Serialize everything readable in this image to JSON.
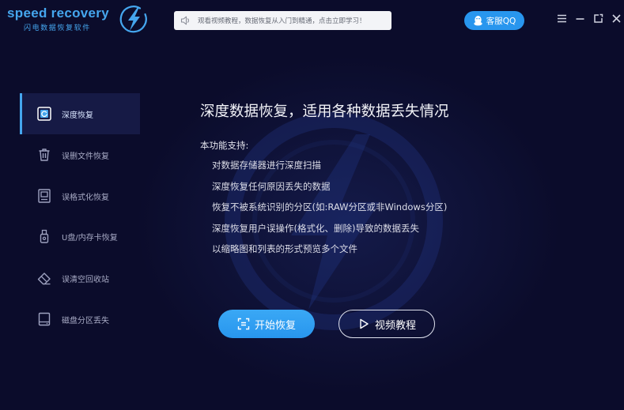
{
  "app": {
    "logo_text": "speed recovery",
    "logo_subtitle": "闪电数据恢复软件",
    "logo_icon": "lightning-icon"
  },
  "notice": {
    "icon": "speaker-icon",
    "text": "观看视频教程，数据恢复从入门到精通，点击立即学习！"
  },
  "header": {
    "qq_button": {
      "icon": "qq-penguin-icon",
      "label": "客服QQ"
    },
    "window_controls": [
      "menu-icon",
      "minimize-icon",
      "restore-icon",
      "close-icon"
    ]
  },
  "sidebar": {
    "items": [
      {
        "label": "深度恢复",
        "icon": "deep-scan-icon",
        "selected": true
      },
      {
        "label": "误删文件恢复",
        "icon": "trash-icon",
        "selected": false
      },
      {
        "label": "误格式化恢复",
        "icon": "format-icon",
        "selected": false
      },
      {
        "label": "U盘/内存卡恢复",
        "icon": "usb-drive-icon",
        "selected": false
      },
      {
        "label": "误清空回收站",
        "icon": "eraser-icon",
        "selected": false
      },
      {
        "label": "磁盘分区丢失",
        "icon": "disk-icon",
        "selected": false
      }
    ]
  },
  "main": {
    "title": "深度数据恢复，适用各种数据丢失情况",
    "features_heading": "本功能支持:",
    "features": [
      "对数据存储器进行深度扫描",
      "深度恢复任何原因丢失的数据",
      "恢复不被系统识别的分区(如:RAW分区或非Windows分区)",
      "深度恢复用户误操作(格式化、删除)导致的数据丢失",
      "以缩略图和列表的形式预览多个文件"
    ],
    "start_button": {
      "icon": "scan-icon",
      "label": "开始恢复"
    },
    "video_button": {
      "icon": "play-icon",
      "label": "视频教程"
    }
  },
  "colors": {
    "background": "#0b0c2b",
    "accent": "#45a6ee",
    "primary_button": "#2896ee",
    "selected_item": "#161a45"
  }
}
